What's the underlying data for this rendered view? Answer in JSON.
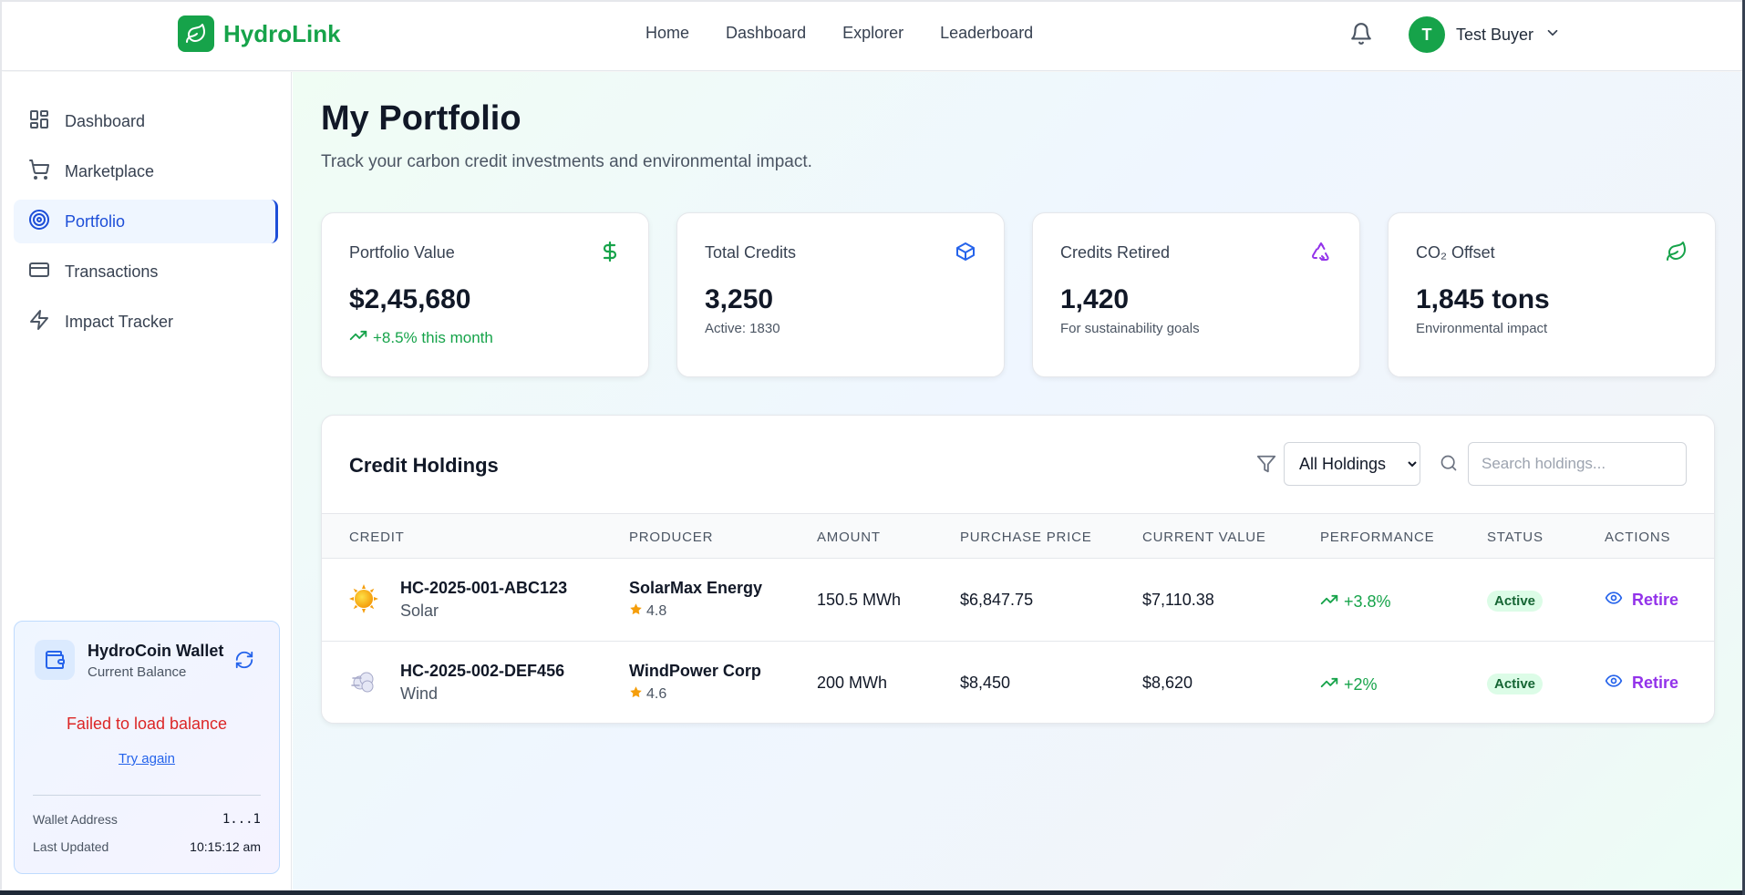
{
  "brand": {
    "name": "HydroLink",
    "accent": "#16a34a"
  },
  "topnav": {
    "items": [
      "Home",
      "Dashboard",
      "Explorer",
      "Leaderboard"
    ]
  },
  "user": {
    "initial": "T",
    "name": "Test Buyer"
  },
  "sidebar": {
    "items": [
      {
        "label": "Dashboard",
        "icon": "grid-icon"
      },
      {
        "label": "Marketplace",
        "icon": "cart-icon"
      },
      {
        "label": "Portfolio",
        "icon": "target-icon",
        "active": true
      },
      {
        "label": "Transactions",
        "icon": "card-icon"
      },
      {
        "label": "Impact Tracker",
        "icon": "bolt-icon"
      }
    ]
  },
  "wallet": {
    "title": "HydroCoin Wallet",
    "subtitle": "Current Balance",
    "error": "Failed to load balance",
    "retry": "Try again",
    "address_label": "Wallet Address",
    "address_value": "1...1",
    "updated_label": "Last Updated",
    "updated_value": "10:15:12 am"
  },
  "page": {
    "title": "My Portfolio",
    "subtitle": "Track your carbon credit investments and environmental impact."
  },
  "stats": [
    {
      "label": "Portfolio Value",
      "value": "$2,45,680",
      "trend": "+8.5% this month",
      "icon": "dollar-icon",
      "color": "#16a34a"
    },
    {
      "label": "Total Credits",
      "value": "3,250",
      "note": "Active: 1830",
      "icon": "cube-icon",
      "color": "#2563eb"
    },
    {
      "label": "Credits Retired",
      "value": "1,420",
      "note": "For sustainability goals",
      "icon": "recycle-icon",
      "color": "#9333ea"
    },
    {
      "label": "CO₂ Offset",
      "value": "1,845 tons",
      "note": "Environmental impact",
      "icon": "leaf-icon",
      "color": "#16a34a"
    }
  ],
  "holdings": {
    "title": "Credit Holdings",
    "filter_value": "All Holdings",
    "search_placeholder": "Search holdings...",
    "columns": [
      "Credit",
      "Producer",
      "Amount",
      "Purchase Price",
      "Current Value",
      "Performance",
      "Status",
      "Actions"
    ],
    "rows": [
      {
        "id": "HC-2025-001-ABC123",
        "type": "Solar",
        "producer": "SolarMax Energy",
        "rating": "4.8",
        "amount": "150.5 MWh",
        "purchase": "$6,847.75",
        "current": "$7,110.38",
        "performance": "+3.8%",
        "status": "Active",
        "action": "Retire"
      },
      {
        "id": "HC-2025-002-DEF456",
        "type": "Wind",
        "producer": "WindPower Corp",
        "rating": "4.6",
        "amount": "200 MWh",
        "purchase": "$8,450",
        "current": "$8,620",
        "performance": "+2%",
        "status": "Active",
        "action": "Retire"
      }
    ]
  }
}
